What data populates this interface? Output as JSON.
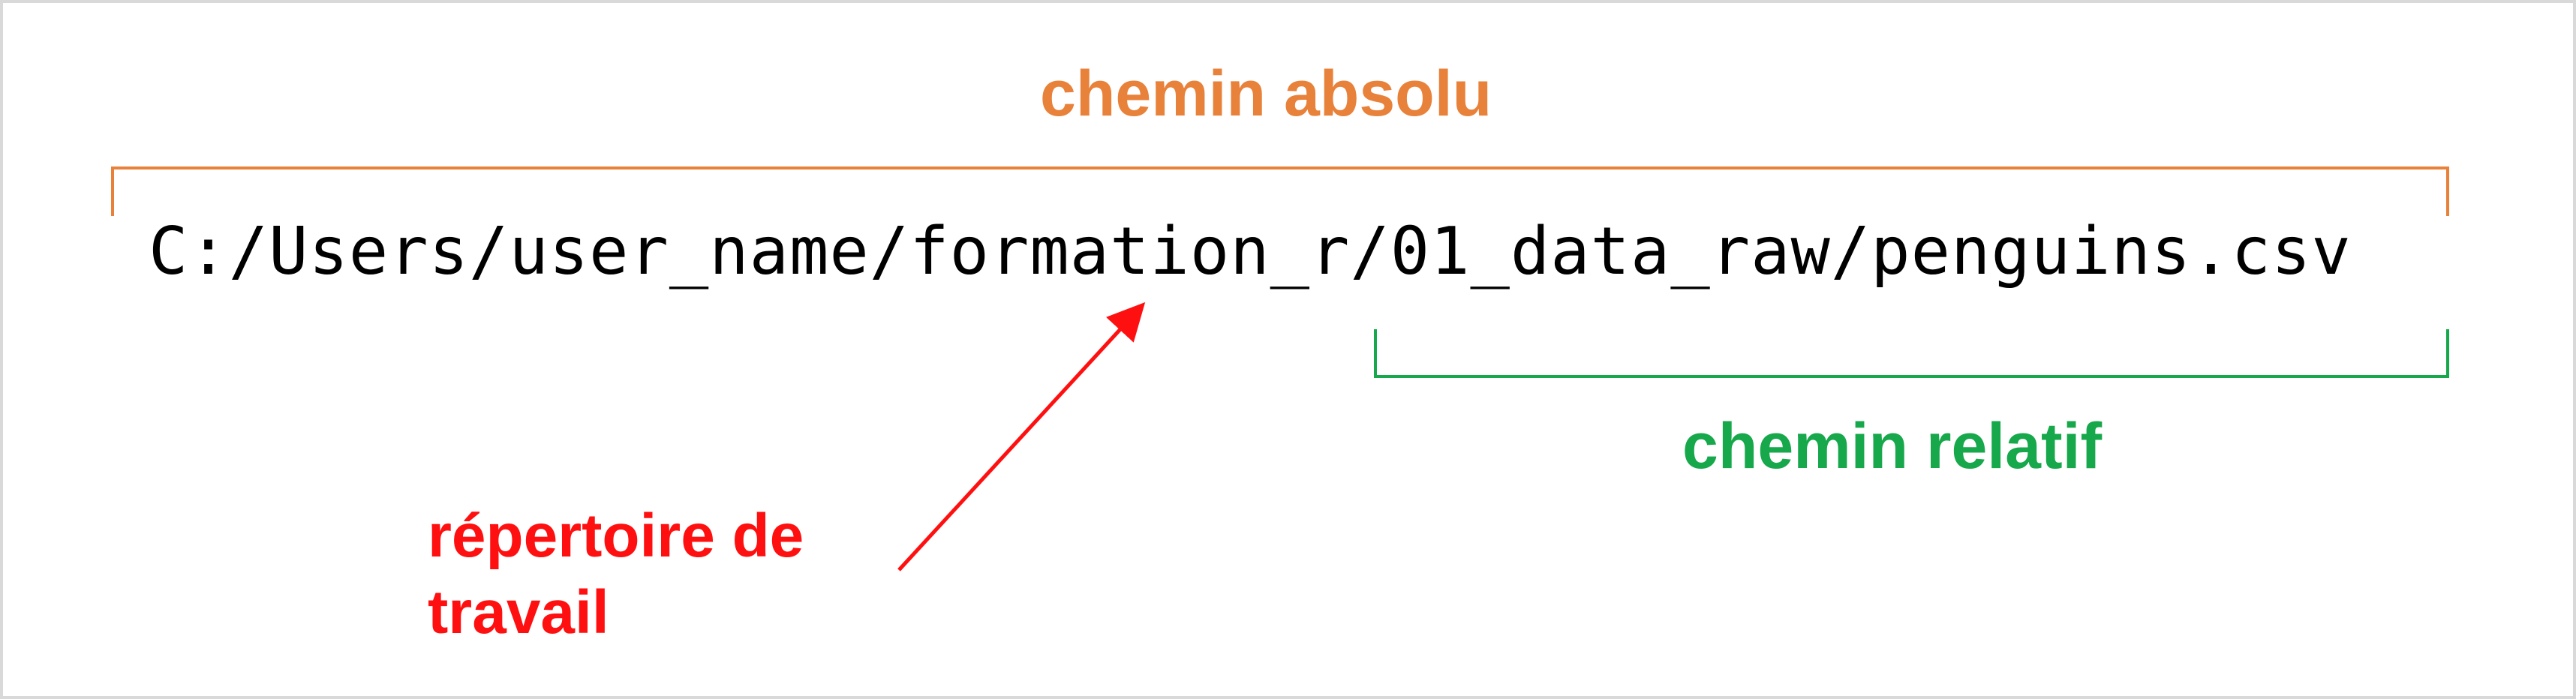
{
  "diagram": {
    "path": "C:/Users/user_name/formation_r/01_data_raw/penguins.csv",
    "labels": {
      "absolute_path": "chemin absolu",
      "relative_path": "chemin relatif",
      "working_directory_line1": "répertoire de",
      "working_directory_line2": "travail"
    },
    "colors": {
      "absolute": "#e8813a",
      "relative": "#16a84b",
      "working_directory": "#ff1010",
      "path_text": "#000000",
      "frame_border": "#d9d9d9",
      "background": "#ffffff"
    }
  }
}
